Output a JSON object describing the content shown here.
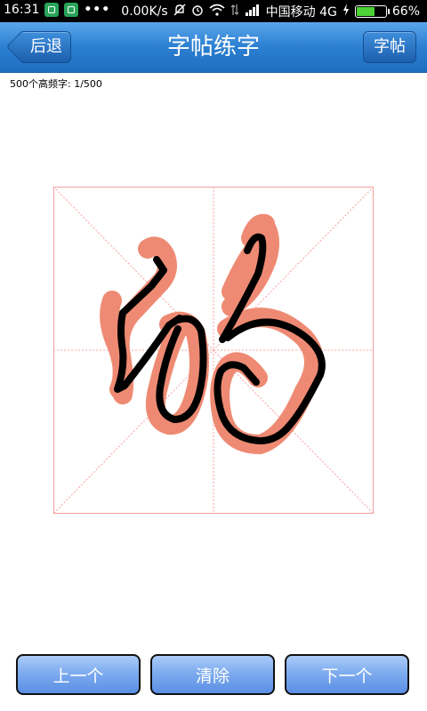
{
  "status_bar": {
    "time": "16:31",
    "net_speed": "0.00K/s",
    "carrier": "中国移动 4G",
    "battery": "66%",
    "battery_level": 0.66
  },
  "header": {
    "back_label": "后退",
    "title": "字帖练字",
    "copybook_label": "字帖"
  },
  "progress_text": "500个高频字: 1/500",
  "practice": {
    "guide_color": "#f4a0a0",
    "template_color": "#ee8a73",
    "stroke_color": "#000000"
  },
  "buttons": {
    "prev": "上一个",
    "clear": "清除",
    "next": "下一个"
  }
}
